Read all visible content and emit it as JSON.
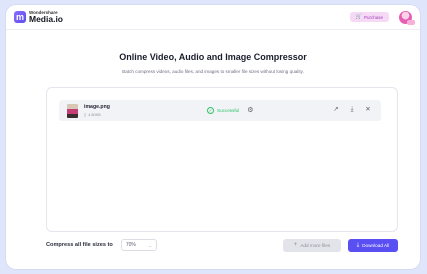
{
  "brand": {
    "small": "Wondershare",
    "name": "Media.io"
  },
  "header": {
    "purchase_label": "Purchase"
  },
  "page": {
    "title": "Online Video, Audio and Image Compressor",
    "subtitle": "Batch compress videos, audio files, and images to smaller file sizes without losing quality."
  },
  "files": [
    {
      "name": "image.png",
      "size": "4.80KB",
      "status": "Successful",
      "status_color": "#2cc36b"
    }
  ],
  "footer": {
    "compress_label": "Compress all file sizes to",
    "compress_value": "70%",
    "add_more_label": "Add more files",
    "download_all_label": "Download All"
  },
  "colors": {
    "accent": "#5a4ff3",
    "purchase_bg": "#f5d9f5",
    "background": "#dfe6fb"
  },
  "icons": [
    "logo-m-icon",
    "cart-icon",
    "avatar",
    "file-icon",
    "check-circle-icon",
    "gear-icon",
    "open-external-icon",
    "download-icon",
    "close-icon",
    "chevron-down-icon",
    "plus-icon"
  ]
}
